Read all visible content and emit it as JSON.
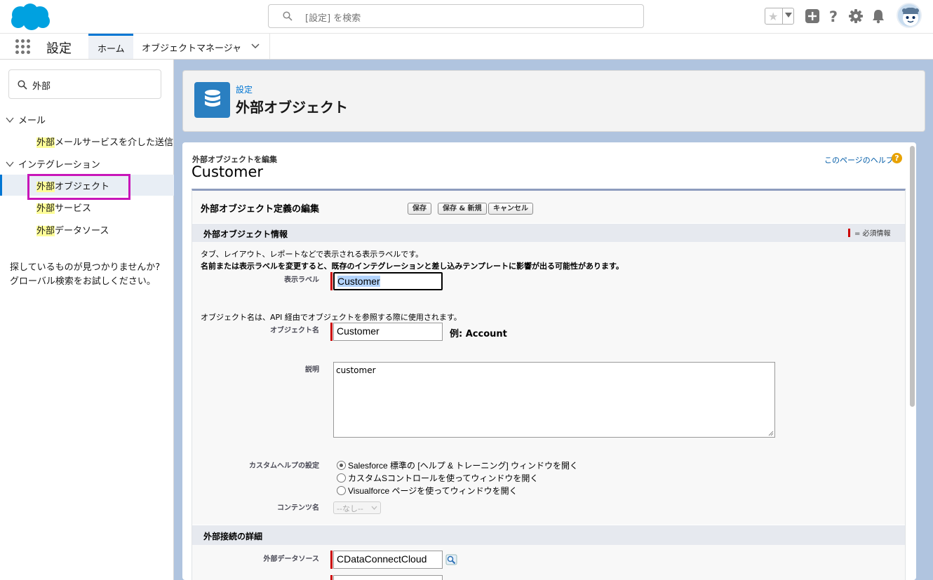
{
  "header": {
    "search_placeholder": "[設定] を検索"
  },
  "app_bar": {
    "app_name": "設定",
    "tabs": [
      {
        "label": "ホーム",
        "active": true
      },
      {
        "label": "オブジェクトマネージャ",
        "active": false
      }
    ]
  },
  "sidebar": {
    "quickfind_value": "外部",
    "groups": [
      {
        "label": "メール",
        "items": [
          {
            "hl": "外部",
            "rest": "メールサービスを介した送信"
          }
        ]
      },
      {
        "label": "インテグレーション",
        "items": [
          {
            "hl": "外部",
            "rest": "オブジェクト"
          },
          {
            "hl": "外部",
            "rest": "サービス"
          },
          {
            "hl": "外部",
            "rest": "データソース"
          }
        ]
      }
    ],
    "not_found_line1": "探しているものが見つかりませんか?",
    "not_found_line2": "グローバル検索をお試しください。"
  },
  "page_header": {
    "breadcrumb": "設定",
    "title": "外部オブジェクト"
  },
  "edit": {
    "subtitle": "外部オブジェクトを編集",
    "title": "Customer",
    "help_link": "このページのヘルプ",
    "help_icon": "?",
    "block_title": "外部オブジェクト定義の編集",
    "buttons": {
      "save": "保存",
      "save_new": "保存 & 新規",
      "cancel": "キャンセル"
    },
    "section_info": "外部オブジェクト情報",
    "required_legend": "= 必須情報",
    "info_line1": "タブ、レイアウト、レポートなどで表示される表示ラベルです。",
    "info_line2": "名前または表示ラベルを変更すると、既存のインテグレーションと差し込みテンプレートに影響が出る可能性があります。",
    "label_field": {
      "label": "表示ラベル",
      "value": "Customer"
    },
    "info_line3": "オブジェクト名は、API 経由でオブジェクトを参照する際に使用されます。",
    "object_name": {
      "label": "オブジェクト名",
      "value": "Customer",
      "example": "例:  Account"
    },
    "description": {
      "label": "説明",
      "value": "customer"
    },
    "custom_help": {
      "label": "カスタムヘルプの設定",
      "options": [
        {
          "label": "Salesforce 標準の [ヘルプ & トレーニング] ウィンドウを開く",
          "checked": true
        },
        {
          "label": "カスタムSコントロールを使ってウィンドウを開く",
          "checked": false
        },
        {
          "label": "Visualforce ページを使ってウィンドウを開く",
          "checked": false
        }
      ]
    },
    "content_name": {
      "label": "コンテンツ名",
      "value": "--なし--"
    },
    "section_connection": "外部接続の詳細",
    "external_data_source": {
      "label": "外部データソース",
      "value": "CDataConnectCloud"
    }
  },
  "colors": {
    "brand": "#0176d3",
    "highlight": "#fdfd98",
    "required": "#cc0000",
    "selection_box": "#c816b9"
  }
}
